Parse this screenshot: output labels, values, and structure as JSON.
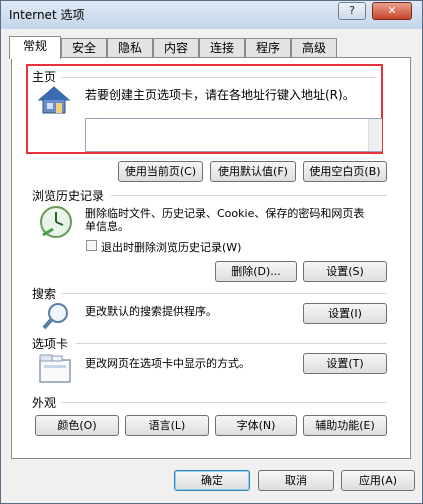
{
  "window": {
    "title": "Internet 选项",
    "help_glyph": "?",
    "close_glyph": "✕"
  },
  "tabs": [
    "常规",
    "安全",
    "隐私",
    "内容",
    "连接",
    "程序",
    "高级"
  ],
  "homepage": {
    "heading": "主页",
    "description": "若要创建主页选项卡，请在各地址行键入地址(R)。",
    "address_value": "",
    "buttons": [
      "使用当前页(C)",
      "使用默认值(F)",
      "使用空白页(B)"
    ],
    "highlight_color": "#e8323a"
  },
  "history": {
    "heading": "浏览历史记录",
    "description": "删除临时文件、历史记录、Cookie、保存的密码和网页表单信息。",
    "checkbox_label": "退出时删除浏览历史记录(W)",
    "checkbox_checked": false,
    "delete_button": "删除(D)...",
    "settings_button": "设置(S)"
  },
  "search": {
    "heading": "搜索",
    "description": "更改默认的搜索提供程序。",
    "settings_button": "设置(I)"
  },
  "tabs_section": {
    "heading": "选项卡",
    "description": "更改网页在选项卡中显示的方式。",
    "settings_button": "设置(T)"
  },
  "appearance": {
    "heading": "外观",
    "buttons": [
      "颜色(O)",
      "语言(L)",
      "字体(N)",
      "辅助功能(E)"
    ]
  },
  "footer": {
    "ok": "确定",
    "cancel": "取消",
    "apply": "应用(A)"
  }
}
